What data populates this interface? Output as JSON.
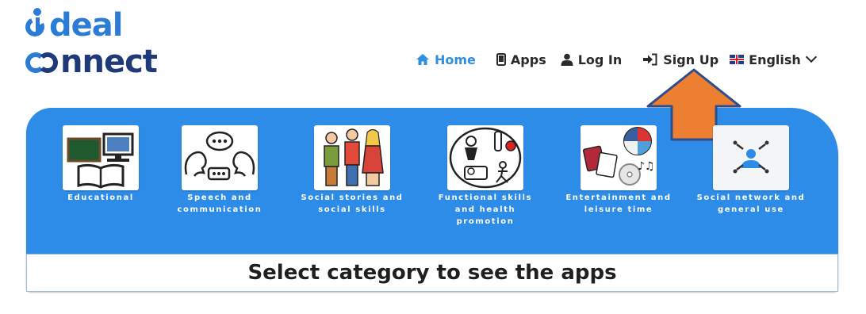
{
  "logo": {
    "word1": "deal",
    "word2": "nnect"
  },
  "nav": {
    "home": "Home",
    "apps": "Apps",
    "login": "Log In",
    "signup": "Sign Up",
    "language": "English"
  },
  "categories": [
    {
      "label": "Educational",
      "icon": "educational-picture"
    },
    {
      "label": "Speech and communication",
      "icon": "speech-bubbles-picture"
    },
    {
      "label": "Social stories and social skills",
      "icon": "people-picture"
    },
    {
      "label": "Functional skills and health promotion",
      "icon": "daily-activities-picture"
    },
    {
      "label": "Entertainment and leisure time",
      "icon": "leisure-picture"
    },
    {
      "label": "Social network and general use",
      "icon": "network-user-picture"
    }
  ],
  "main": {
    "prompt": "Select category to see the apps"
  },
  "colors": {
    "brand_blue": "#2b7cd6",
    "brand_navy": "#1e3a78",
    "panel_blue": "#2d8ce8",
    "arrow_orange": "#ec7f32"
  }
}
